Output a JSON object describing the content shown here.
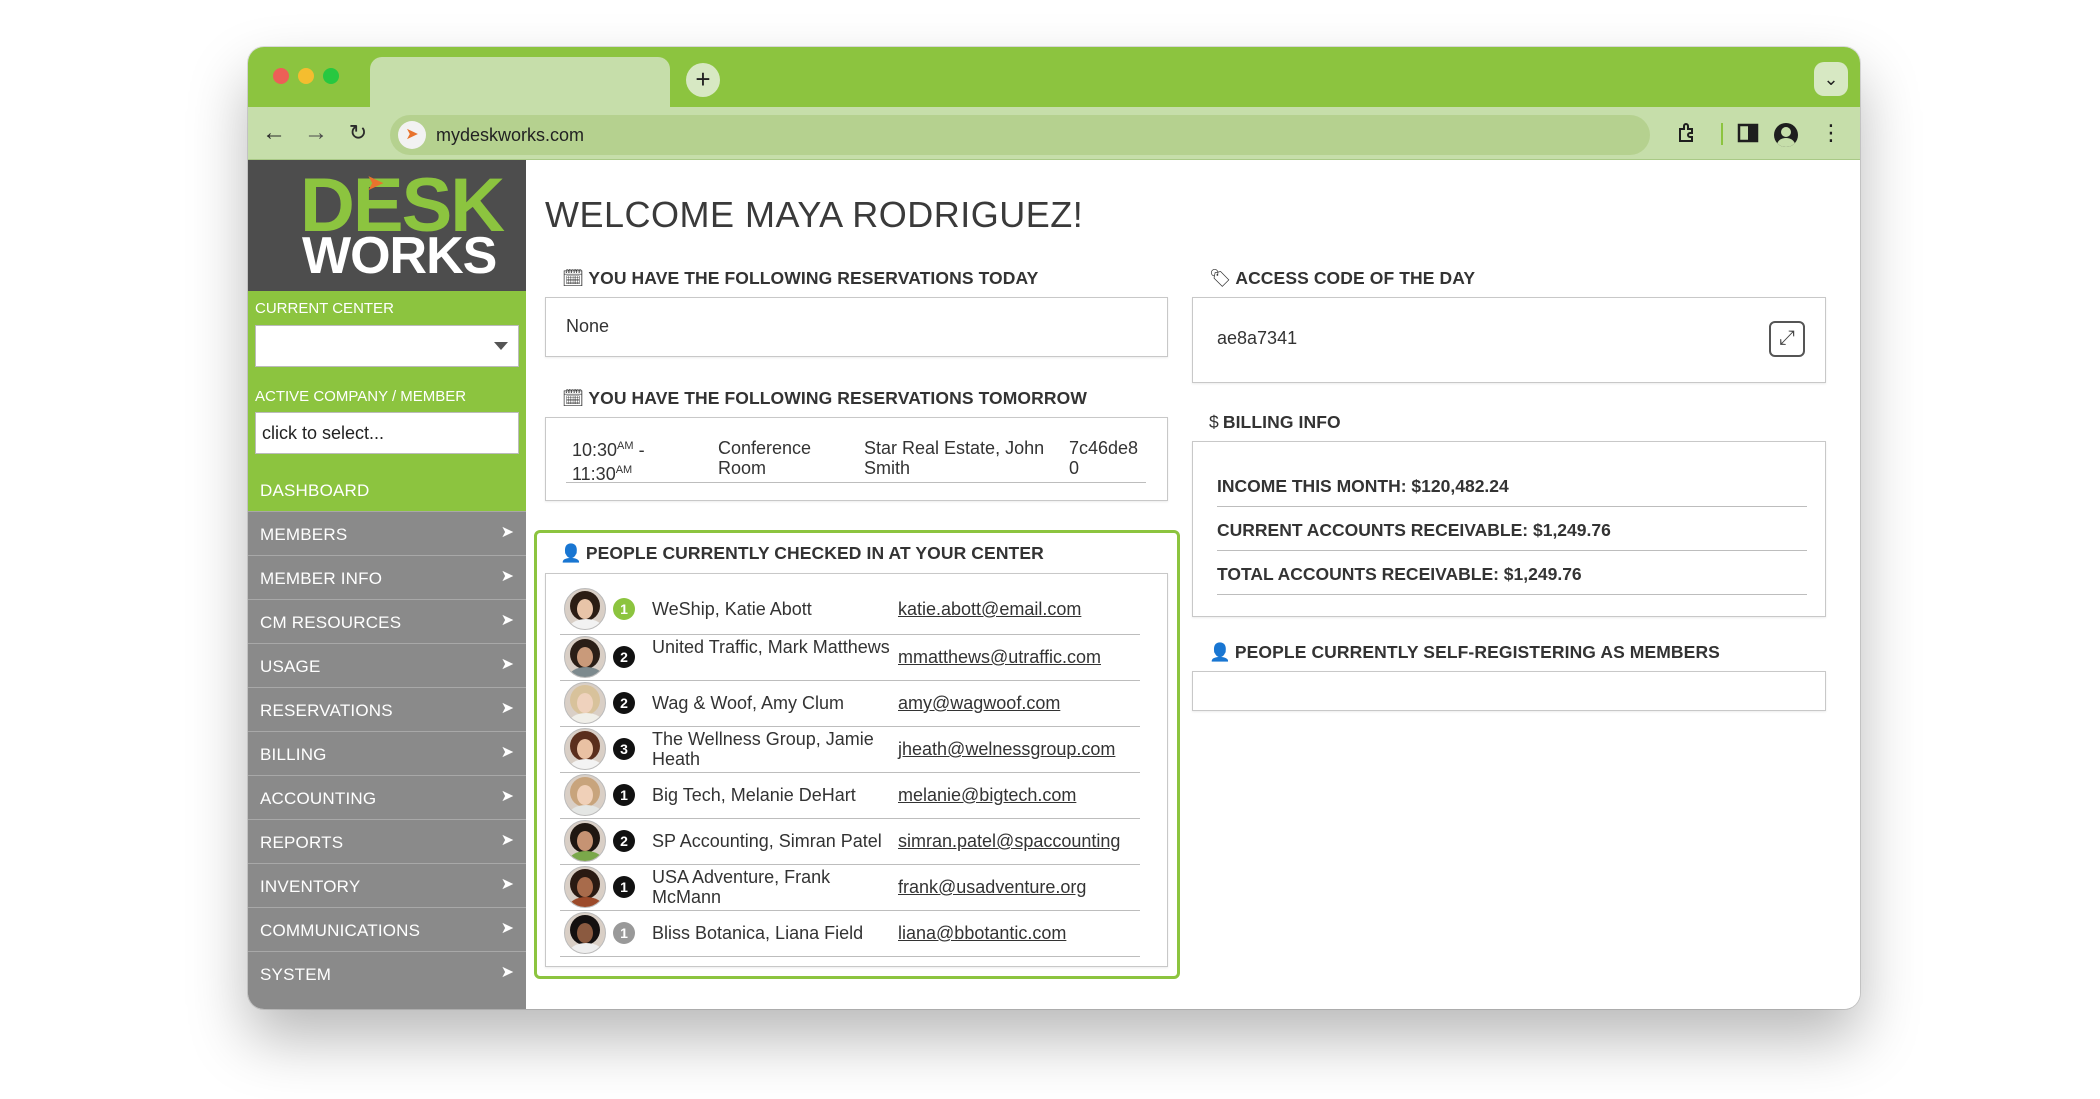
{
  "browser": {
    "url": "mydeskworks.com",
    "new_tab_glyph": "+",
    "tab_menu_glyph": "⌄",
    "back_glyph": "←",
    "forward_glyph": "→",
    "reload_glyph": "↻",
    "more_glyph": "⋮",
    "accent_color": "#8cc43f"
  },
  "logo": {
    "line1": "DESK",
    "line2": "WORKS"
  },
  "sidebar": {
    "current_center_label": "CURRENT CENTER",
    "current_center_value": "",
    "active_company_label": "ACTIVE COMPANY / MEMBER",
    "active_company_placeholder": "click to select...",
    "arrow_glyph": "➤",
    "menu": [
      {
        "label": "DASHBOARD"
      },
      {
        "label": "MEMBERS"
      },
      {
        "label": "MEMBER INFO"
      },
      {
        "label": "CM RESOURCES"
      },
      {
        "label": "USAGE"
      },
      {
        "label": "RESERVATIONS"
      },
      {
        "label": "BILLING"
      },
      {
        "label": "ACCOUNTING"
      },
      {
        "label": "REPORTS"
      },
      {
        "label": "INVENTORY"
      },
      {
        "label": "COMMUNICATIONS"
      },
      {
        "label": "SYSTEM"
      }
    ]
  },
  "main": {
    "welcome": "WELCOME MAYA RODRIGUEZ!",
    "res_today": {
      "title": "YOU HAVE THE FOLLOWING RESERVATIONS TODAY",
      "value": "None"
    },
    "res_tomorrow": {
      "title": "YOU HAVE THE FOLLOWING RESERVATIONS TOMORROW",
      "row": {
        "time_start": "10:30",
        "time_start_suffix": "AM",
        "time_dash": "-",
        "time_end": "11:30",
        "time_end_suffix": "AM",
        "room_line1": "Conference",
        "room_line2": "Room",
        "member_line1": "Star Real Estate, John",
        "member_line2": "Smith",
        "code_line1": "7c46de8",
        "code_line2": "0"
      }
    },
    "checked_in": {
      "title": "PEOPLE CURRENTLY CHECKED IN AT YOUR CENTER",
      "people": [
        {
          "badge": "1",
          "badge_color": "#8cc43f",
          "name": "WeShip, Katie Abott",
          "email": "katie.abott@email.com"
        },
        {
          "badge": "2",
          "badge_color": "#111111",
          "name": "United Traffic, Mark Matthews",
          "email": "mmatthews@utraffic.com"
        },
        {
          "badge": "2",
          "badge_color": "#111111",
          "name": "Wag & Woof, Amy Clum",
          "email": "amy@wagwoof.com"
        },
        {
          "badge": "3",
          "badge_color": "#111111",
          "name": "The Wellness Group, Jamie Heath",
          "email": "jheath@welnessgroup.com"
        },
        {
          "badge": "1",
          "badge_color": "#111111",
          "name": "Big Tech, Melanie DeHart",
          "email": "melanie@bigtech.com"
        },
        {
          "badge": "2",
          "badge_color": "#111111",
          "name": "SP Accounting, Simran Patel",
          "email": "simran.patel@spaccounting"
        },
        {
          "badge": "1",
          "badge_color": "#111111",
          "name": "USA Adventure, Frank McMann",
          "email": "frank@usadventure.org"
        },
        {
          "badge": "1",
          "badge_color": "#999999",
          "name": "Bliss Botanica, Liana Field",
          "email": "liana@bbotantic.com"
        }
      ]
    },
    "access_code": {
      "title": "ACCESS CODE OF THE DAY",
      "value": "ae8a7341",
      "expand_glyph": "⤢"
    },
    "billing": {
      "title": "BILLING INFO",
      "lines": [
        "INCOME THIS MONTH: $120,482.24",
        "CURRENT ACCOUNTS RECEIVABLE: $1,249.76",
        "TOTAL ACCOUNTS RECEIVABLE: $1,249.76"
      ]
    },
    "self_registering": {
      "title": "PEOPLE CURRENTLY SELF-REGISTERING AS MEMBERS"
    }
  }
}
